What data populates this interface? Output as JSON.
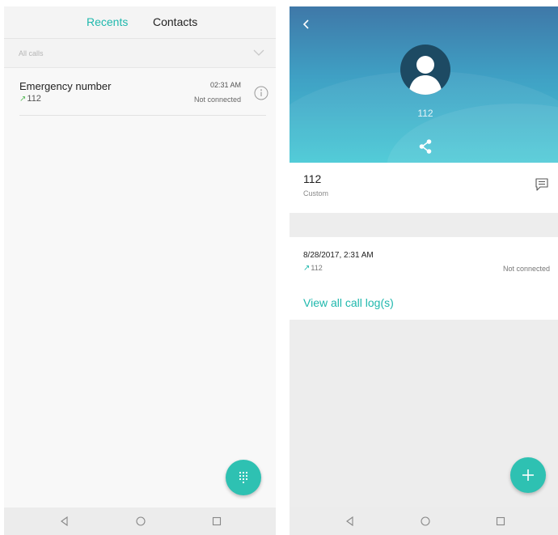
{
  "left_screen": {
    "tabs": [
      {
        "label": "Recents",
        "active": true
      },
      {
        "label": "Contacts",
        "active": false
      }
    ],
    "filter": {
      "label": "All calls"
    },
    "calls": [
      {
        "name": "Emergency number",
        "number": "112",
        "time": "02:31 AM",
        "status": "Not connected",
        "direction": "outgoing-arrow-icon"
      }
    ],
    "fab": {
      "icon": "dialpad-icon"
    }
  },
  "right_screen": {
    "header": {
      "number": "112",
      "back_icon": "back-arrow-icon",
      "share_icon": "share-icon"
    },
    "contact": {
      "number": "112",
      "type": "Custom",
      "message_icon": "message-icon"
    },
    "call_log": {
      "date": "8/28/2017, 2:31 AM",
      "number": "112",
      "status": "Not connected",
      "view_all_label": "View all call log(s)"
    },
    "fab": {
      "icon": "add-icon"
    }
  },
  "navbar": {
    "buttons": [
      "back-icon",
      "home-icon",
      "recents-icon"
    ]
  },
  "colors": {
    "accent": "#1fb8ad",
    "fab": "#2ec1b2",
    "hero_top": "#3f78a8",
    "hero_bottom": "#49c9d6",
    "outgoing_arrow": "#5ab95a"
  }
}
